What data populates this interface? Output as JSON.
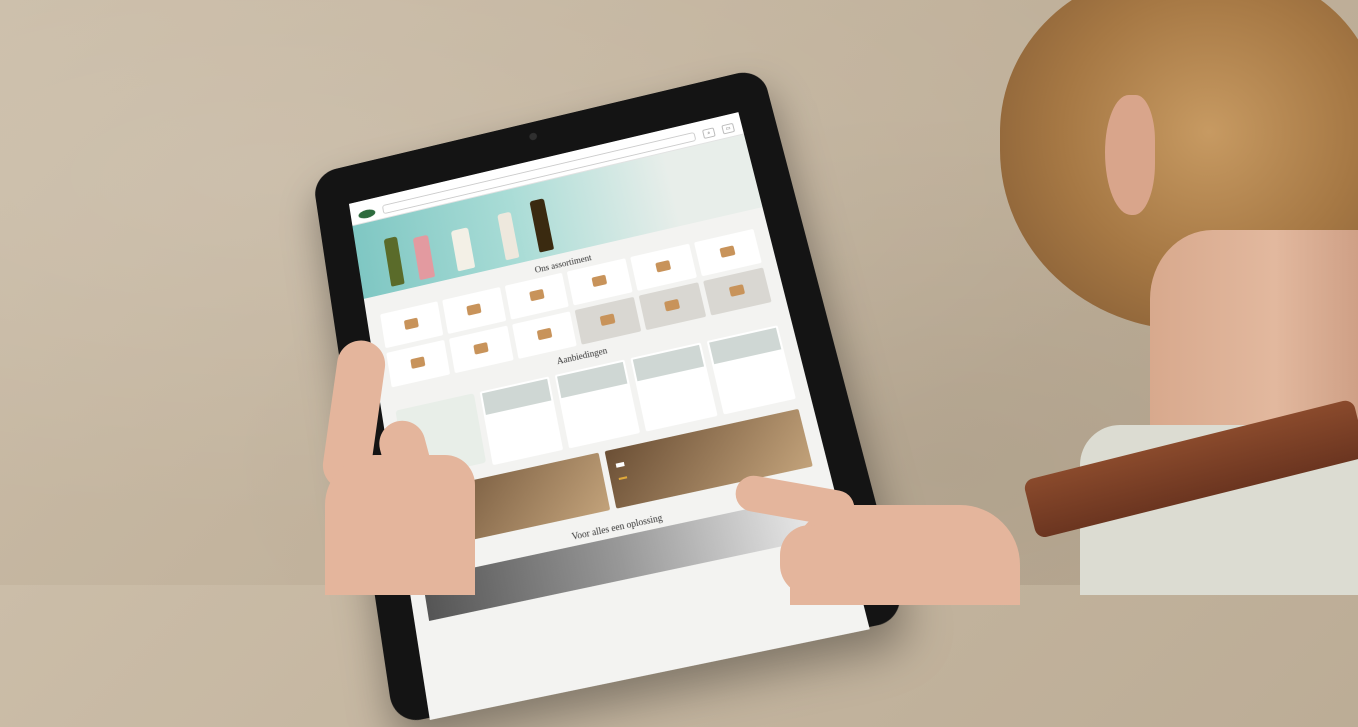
{
  "colors": {
    "brand_green": "#2d6b3d",
    "accent_orange": "#e0a93a",
    "price_red": "#c0392b"
  },
  "tablet": {
    "topnav": [
      "",
      "",
      "",
      "",
      "",
      ""
    ],
    "header": {
      "search_placeholder": "",
      "icons": [
        "search-icon",
        "cart-icon"
      ]
    },
    "hero": {
      "bottles": 5
    },
    "sections": {
      "assortment_title": "Ons assortiment",
      "offers_title": "Aanbiedingen",
      "bottom_title": "Voor alles een oplossing"
    },
    "categories": [
      {
        "label": ""
      },
      {
        "label": ""
      },
      {
        "label": ""
      },
      {
        "label": ""
      },
      {
        "label": ""
      },
      {
        "label": ""
      },
      {
        "label": ""
      },
      {
        "label": ""
      },
      {
        "label": ""
      },
      {
        "label": ""
      },
      {
        "label": ""
      },
      {
        "label": ""
      }
    ],
    "offers": [
      {
        "label": ""
      },
      {
        "label": ""
      },
      {
        "label": ""
      },
      {
        "label": ""
      }
    ],
    "banners": [
      {
        "label": "",
        "button": ""
      },
      {
        "label": "",
        "button": ""
      }
    ]
  }
}
